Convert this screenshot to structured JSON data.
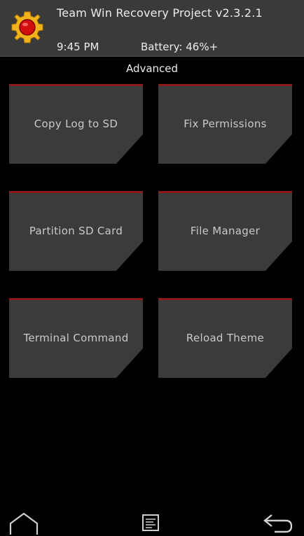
{
  "header": {
    "title": "Team Win Recovery Project  v2.3.2.1",
    "time": "9:45 PM",
    "battery": "Battery: 46%+"
  },
  "page": {
    "title": "Advanced"
  },
  "tiles": [
    {
      "label": "Copy Log to SD"
    },
    {
      "label": "Fix Permissions"
    },
    {
      "label": "Partition SD Card"
    },
    {
      "label": "File Manager"
    },
    {
      "label": "Terminal Command"
    },
    {
      "label": "Reload Theme"
    }
  ],
  "nav": {
    "home_icon": "home-icon",
    "log_icon": "console-log-icon",
    "back_icon": "back-arrow-icon"
  },
  "colors": {
    "header_bg": "#3a3a3a",
    "tile_bg": "#3b3b3b",
    "tile_accent": "#8b1a1a",
    "background": "#000000"
  }
}
